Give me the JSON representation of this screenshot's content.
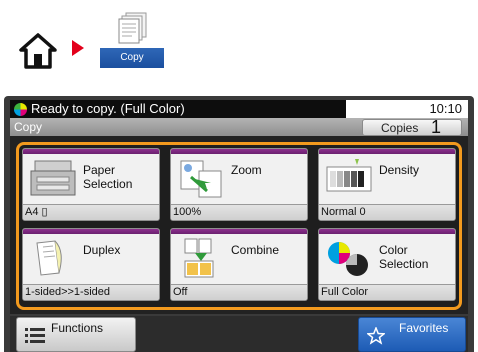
{
  "breadcrumb": {
    "home_icon": "home-icon",
    "separator_icon": "triangle-right-icon",
    "current_label": "Copy"
  },
  "status": {
    "message": "Ready to copy. (Full Color)",
    "time": "10:10"
  },
  "mode": {
    "title": "Copy",
    "copies_label": "Copies",
    "copies_value": "1"
  },
  "functions": [
    {
      "label": "Paper\nSelection",
      "value": "A4 ▯",
      "icon": "paper-tray-icon"
    },
    {
      "label": "Zoom",
      "value": "100%",
      "icon": "zoom-icon"
    },
    {
      "label": "Density",
      "value": "Normal 0",
      "icon": "density-icon"
    },
    {
      "label": "Duplex",
      "value": "1-sided>>1-sided",
      "icon": "duplex-icon"
    },
    {
      "label": "Combine",
      "value": "Off",
      "icon": "combine-icon"
    },
    {
      "label": "Color\nSelection",
      "value": "Full Color",
      "icon": "color-selection-icon"
    }
  ],
  "bottom": {
    "functions_label": "Functions",
    "favorites_label": "Favorites"
  },
  "colors": {
    "accent_orange": "#f39a1e",
    "tile_header": "#8d2f8e",
    "breadcrumb_arrow": "#e3001b",
    "favorites_blue": "#2a68c2"
  }
}
